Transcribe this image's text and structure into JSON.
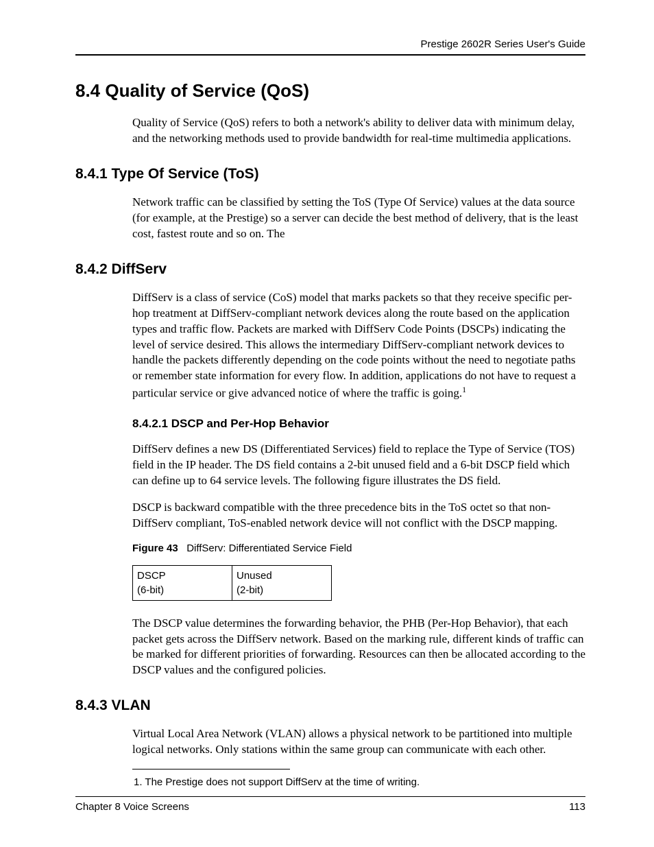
{
  "header": {
    "guide_title": "Prestige 2602R Series User's Guide"
  },
  "section_8_4": {
    "heading": "8.4  Quality of Service (QoS)",
    "intro": "Quality of Service (QoS) refers to both a network's ability to deliver data with minimum delay, and the networking methods used to provide bandwidth for real-time multimedia applications."
  },
  "section_8_4_1": {
    "heading": "8.4.1  Type Of Service (ToS)",
    "body": "Network traffic can be classified by setting the ToS (Type Of Service) values at the data source (for example, at the Prestige) so a server can decide the best method of delivery, that is the least cost, fastest route and so on. The"
  },
  "section_8_4_2": {
    "heading": "8.4.2  DiffServ",
    "body": "DiffServ is a class of service (CoS) model that marks packets so that they receive specific per-hop treatment at DiffServ-compliant network devices along the route based on the application types and traffic flow. Packets are marked with DiffServ Code Points (DSCPs) indicating the level of service desired. This allows the intermediary DiffServ-compliant network devices to handle the packets differently depending on the code points without the need to negotiate paths or remember state information for every flow. In addition, applications do not have to request a particular service or give advanced notice of where the traffic is going.",
    "footnote_marker": "1"
  },
  "section_8_4_2_1": {
    "heading": "8.4.2.1  DSCP and Per-Hop Behavior",
    "para1": "DiffServ defines a new DS (Differentiated Services) field to replace the Type of Service (TOS) field in the IP header. The DS field contains a 2-bit unused field and a 6-bit DSCP field which can define up to 64 service levels. The following figure illustrates the DS field.",
    "para2": "DSCP is backward compatible with the three precedence bits in the ToS octet so that non-DiffServ compliant, ToS-enabled network device will not conflict with the DSCP mapping.",
    "figure_label": "Figure 43",
    "figure_caption": "DiffServ: Differentiated Service Field",
    "table": {
      "col1_line1": "DSCP",
      "col1_line2": "(6-bit)",
      "col2_line1": "Unused",
      "col2_line2": "(2-bit)"
    },
    "para3": "The DSCP value determines the forwarding behavior, the PHB (Per-Hop Behavior), that each packet gets across the DiffServ network.  Based on the marking rule, different kinds of traffic can be marked for different priorities of forwarding. Resources can then be allocated according to the DSCP values and the configured policies."
  },
  "section_8_4_3": {
    "heading": "8.4.3  VLAN",
    "body": "Virtual Local Area Network (VLAN) allows a physical network to be partitioned into multiple logical networks. Only stations within the same group can communicate with each other."
  },
  "footnote": {
    "text": "1.  The Prestige does not support DiffServ at the time of writing."
  },
  "footer": {
    "chapter": "Chapter 8 Voice Screens",
    "page": "113"
  }
}
